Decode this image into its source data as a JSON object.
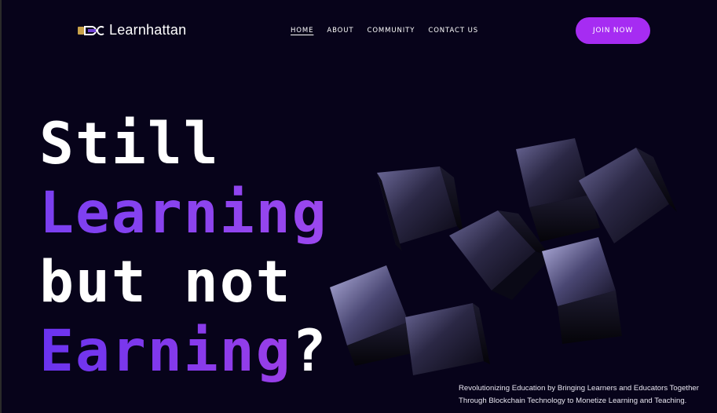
{
  "brand": {
    "name": "Learnhattan",
    "logo_icon": "learnhattan-logo-icon"
  },
  "nav": {
    "items": [
      {
        "label": "HOME",
        "active": true
      },
      {
        "label": "ABOUT",
        "active": false
      },
      {
        "label": "COMMUNITY",
        "active": false
      },
      {
        "label": "CONTACT US",
        "active": false
      }
    ],
    "cta_label": "JOIN NOW"
  },
  "hero": {
    "line1": "Still",
    "line2": "Learning",
    "line3": "but not",
    "line4_highlight": "Earning",
    "line4_suffix": "?",
    "tagline_line1": "Revolutionizing Education by Bringing Learners and Educators Together",
    "tagline_line2": "Through Blockchain Technology to Monetize Learning and Teaching."
  },
  "colors": {
    "background": "#07031a",
    "accent": "#a62cf2",
    "headline_purple": "#8a40f0",
    "text": "#ffffff"
  }
}
